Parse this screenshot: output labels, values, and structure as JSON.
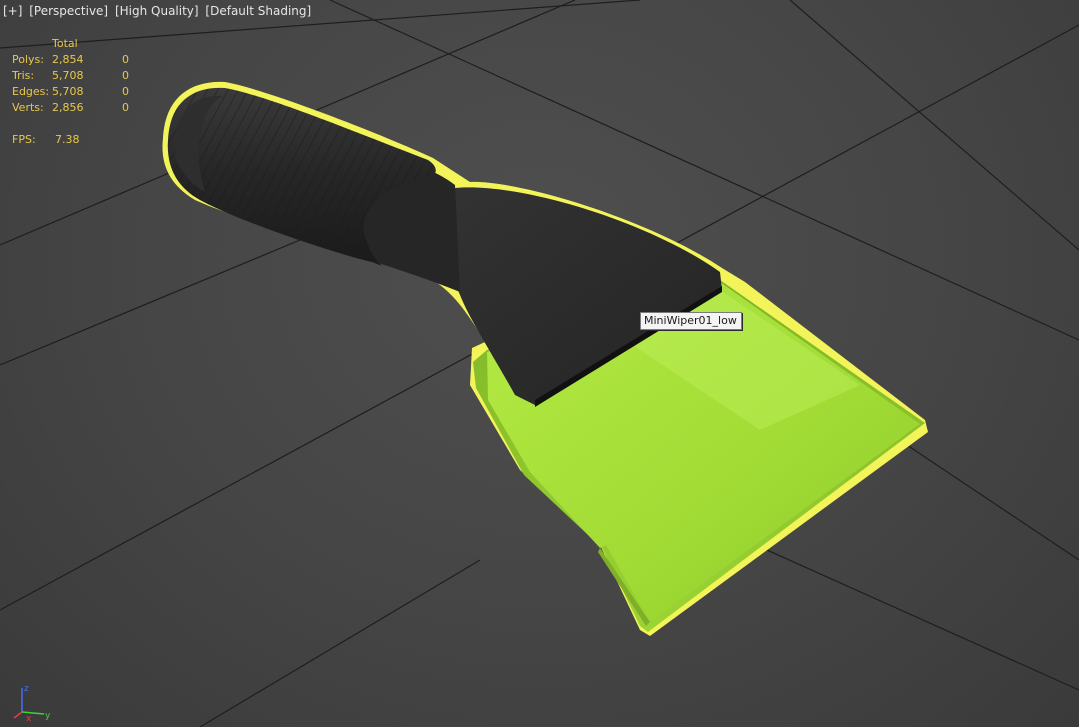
{
  "viewport_labels": {
    "menu": "[+]",
    "view": "[Perspective]",
    "quality": "[High Quality]",
    "shading": "[Default Shading]"
  },
  "stats": {
    "header": "Total",
    "rows": [
      {
        "label": "Polys:",
        "total": "2,854",
        "selected": "0"
      },
      {
        "label": "Tris:",
        "total": "5,708",
        "selected": "0"
      },
      {
        "label": "Edges:",
        "total": "5,708",
        "selected": "0"
      },
      {
        "label": "Verts:",
        "total": "2,856",
        "selected": "0"
      }
    ],
    "fps_label": "FPS:",
    "fps_value": "7.38"
  },
  "object_tooltip": "MiniWiper01_low",
  "axis_labels": {
    "z": "z",
    "x": "x",
    "y": "y"
  },
  "colors": {
    "background": "#474747",
    "grid_line": "#1e1e1e",
    "selection_outline": "#f3f35a",
    "blade_green": "#a8e03a",
    "handle_black": "#2a2a2a",
    "stats_text": "#e8c84a"
  }
}
